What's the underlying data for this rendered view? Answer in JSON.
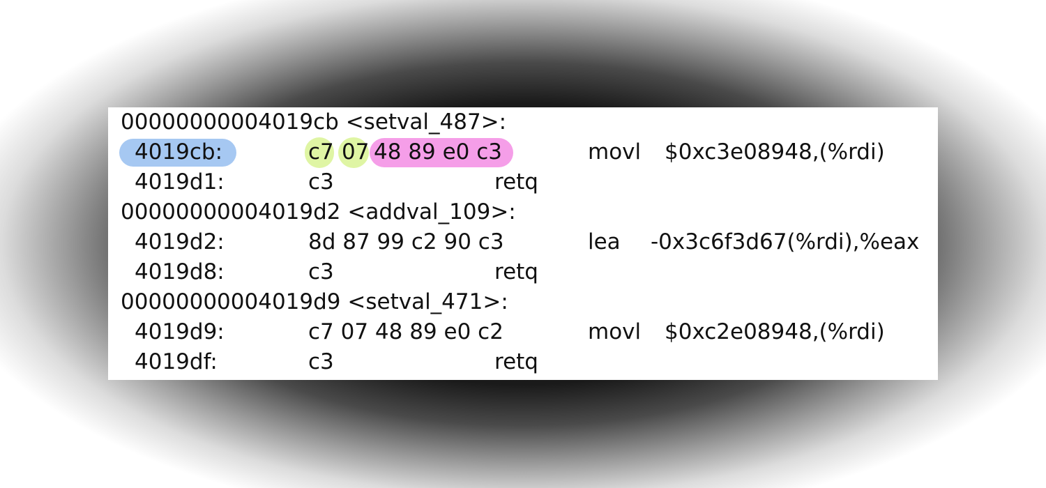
{
  "colors": {
    "panel_background": "#ffffff",
    "text": "#111111",
    "highlight_address": "#a6c8f2",
    "highlight_bytes_green": "#dff5a4",
    "highlight_bytes_pink": "#f59ee8"
  },
  "disassembly": {
    "block1": {
      "header": "00000000004019cb <setval_487>:",
      "line1": {
        "address": "4019cb:",
        "byte_group1": "c7",
        "byte_group2": "07",
        "byte_group3": "48 89 e0 c3",
        "mnemonic": "movl",
        "operands": "$0xc3e08948,(%rdi)"
      },
      "line2": {
        "address": "4019d1:",
        "bytes": "c3",
        "mnemonic": "retq"
      }
    },
    "block2": {
      "header": "00000000004019d2 <addval_109>:",
      "line1": {
        "address": "4019d2:",
        "bytes": "8d 87 99 c2 90 c3",
        "mnemonic": "lea",
        "operands": "-0x3c6f3d67(%rdi),%eax"
      },
      "line2": {
        "address": "4019d8:",
        "bytes": "c3",
        "mnemonic": "retq"
      }
    },
    "block3": {
      "header": "00000000004019d9 <setval_471>:",
      "line1": {
        "address": "4019d9:",
        "bytes": "c7 07 48 89 e0 c2",
        "mnemonic": "movl",
        "operands": "$0xc2e08948,(%rdi)"
      },
      "line2": {
        "address": "4019df:",
        "bytes": "c3",
        "mnemonic": "retq"
      }
    }
  }
}
